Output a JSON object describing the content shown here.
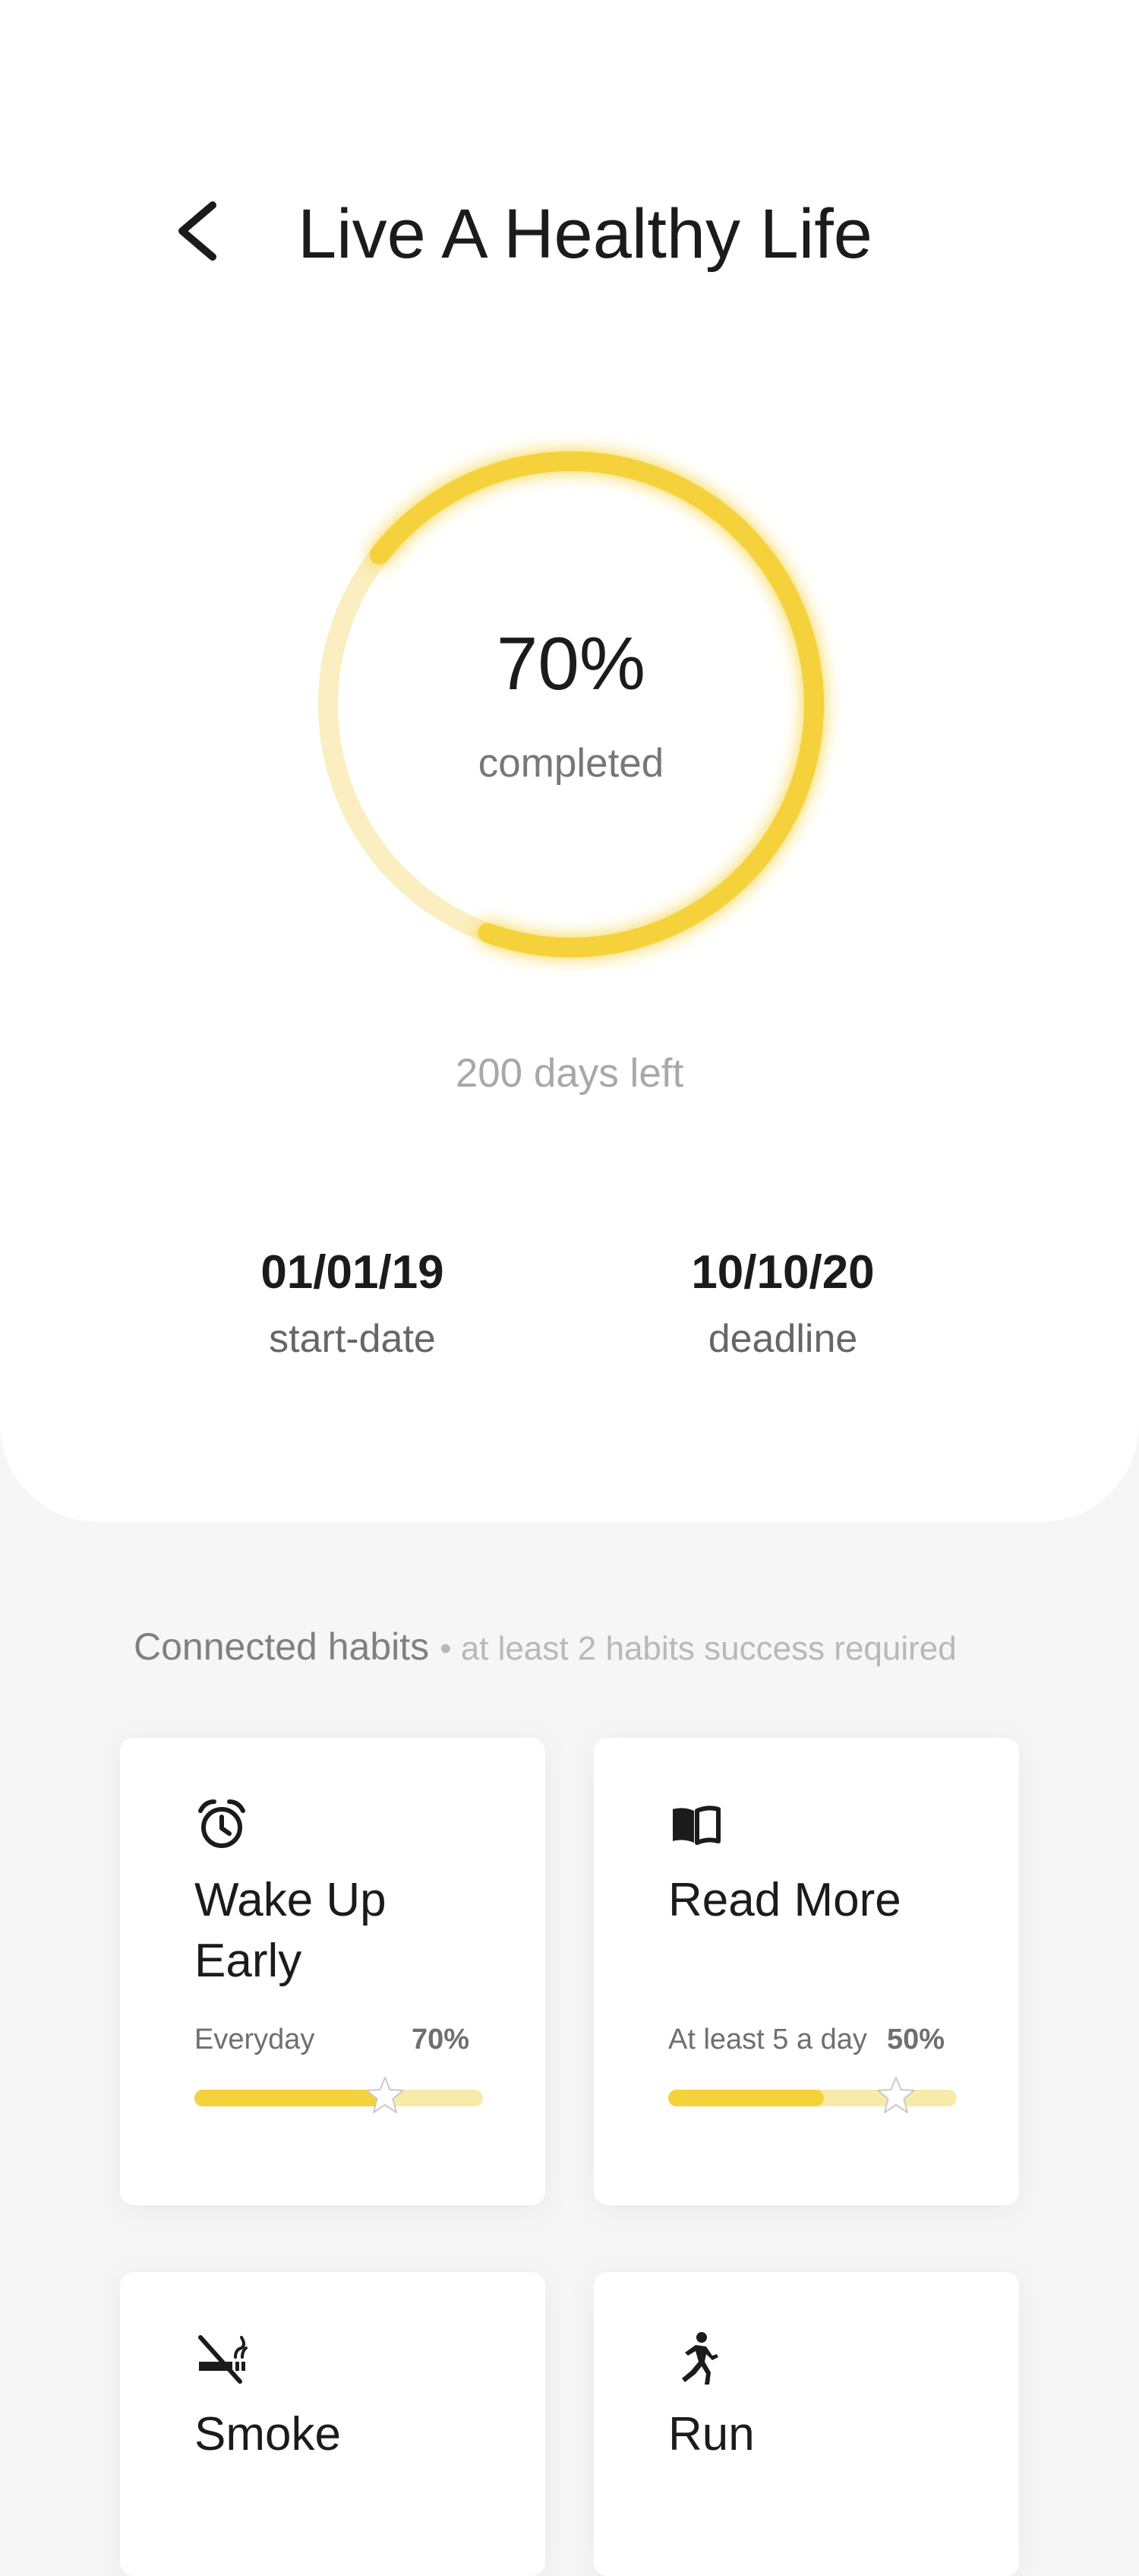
{
  "header": {
    "title": "Live A Healthy Life",
    "back_icon": "chevron-left-icon"
  },
  "progress": {
    "percent": 70,
    "percent_text": "70%",
    "label": "completed",
    "days_left": "200 days left",
    "color": "#f5d23a",
    "track_color": "#fbeec0"
  },
  "dates": {
    "start_value": "01/01/19",
    "start_label": "start-date",
    "deadline_value": "10/10/20",
    "deadline_label": "deadline"
  },
  "habits_section": {
    "title": "Connected habits",
    "subtitle": "• at least 2 habits success required"
  },
  "habits": [
    {
      "name": "Wake Up Early",
      "icon": "alarm-clock-icon",
      "frequency": "Everyday",
      "percent_text": "70%",
      "progress": 0.66
    },
    {
      "name": "Read More",
      "icon": "book-icon",
      "frequency": "At least 5 a day",
      "percent_text": "50%",
      "progress": 0.54
    },
    {
      "name": "Smoke",
      "icon": "no-smoking-icon"
    },
    {
      "name": "Run",
      "icon": "running-icon"
    }
  ],
  "colors": {
    "accent": "#f5d23a",
    "accent_light": "#f8ebaa",
    "background": "#f6f6f6"
  }
}
